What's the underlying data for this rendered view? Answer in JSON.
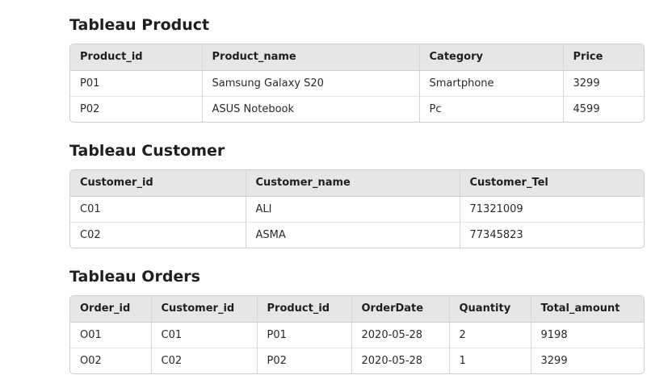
{
  "tables": [
    {
      "title": "Tableau Product",
      "columns": [
        "Product_id",
        "Product_name",
        "Category",
        "Price"
      ],
      "rows": [
        [
          "P01",
          "Samsung Galaxy S20",
          "Smartphone",
          "3299"
        ],
        [
          "P02",
          "ASUS Notebook",
          "Pc",
          "4599"
        ]
      ]
    },
    {
      "title": "Tableau Customer",
      "columns": [
        "Customer_id",
        "Customer_name",
        "Customer_Tel"
      ],
      "rows": [
        [
          "C01",
          "ALI",
          "71321009"
        ],
        [
          "C02",
          "ASMA",
          "77345823"
        ]
      ]
    },
    {
      "title": "Tableau Orders",
      "columns": [
        "Order_id",
        "Customer_id",
        "Product_id",
        "OrderDate",
        "Quantity",
        "Total_amount"
      ],
      "rows": [
        [
          "O01",
          "C01",
          "P01",
          "2020-05-28",
          "2",
          "9198"
        ],
        [
          "O02",
          "C02",
          "P02",
          "2020-05-28",
          "1",
          "3299"
        ]
      ]
    }
  ]
}
